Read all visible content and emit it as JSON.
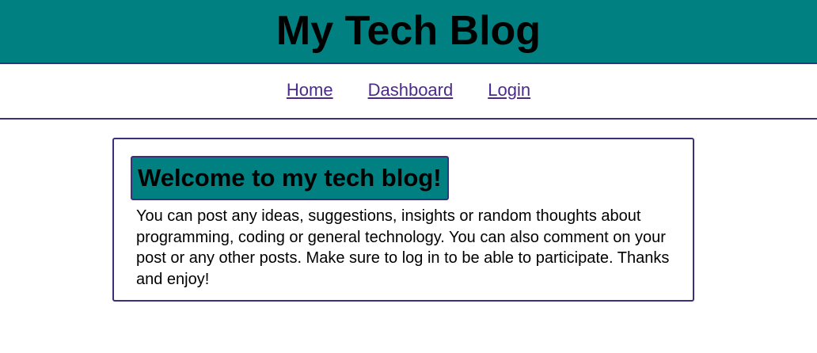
{
  "header": {
    "title": "My Tech Blog"
  },
  "nav": {
    "items": [
      {
        "label": "Home"
      },
      {
        "label": "Dashboard"
      },
      {
        "label": "Login"
      }
    ]
  },
  "main": {
    "heading": "Welcome to my tech blog!",
    "body": "You can post any ideas, suggestions, insights or random thoughts about programming, coding or general technology. You can also comment on your post or any other posts. Make sure to log in to be able to participate. Thanks and enjoy!"
  },
  "colors": {
    "header_bg": "#008080",
    "border": "#3b2f7a",
    "link": "#4b2a8a"
  }
}
